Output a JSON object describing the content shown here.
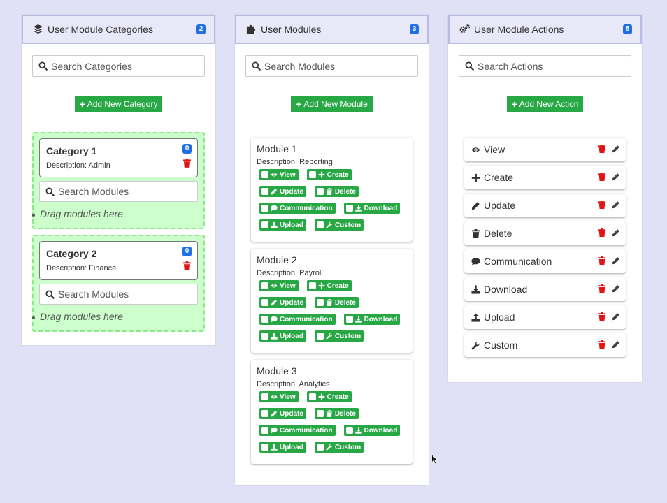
{
  "colors": {
    "accent_green": "#28a745",
    "badge_blue": "#1f6fe6",
    "danger_red": "#e01414",
    "drop_zone": "#ccffcc",
    "background": "#e0e0f7"
  },
  "categories_panel": {
    "title": "User Module Categories",
    "icon": "layers-icon",
    "count": "2",
    "search_placeholder": "Search Categories",
    "add_label": "Add New Category",
    "items": [
      {
        "title": "Category 1",
        "description": "Description: Admin",
        "count": "0",
        "search_placeholder": "Search Modules",
        "drag_hint": "Drag modules here"
      },
      {
        "title": "Category 2",
        "description": "Description: Finance",
        "count": "0",
        "search_placeholder": "Search Modules",
        "drag_hint": "Drag modules here"
      }
    ]
  },
  "modules_panel": {
    "title": "User Modules",
    "icon": "puzzle-icon",
    "count": "3",
    "search_placeholder": "Search Modules",
    "add_label": "Add New Module",
    "items": [
      {
        "title": "Module 1",
        "description": "Description: Reporting"
      },
      {
        "title": "Module 2",
        "description": "Description: Payroll"
      },
      {
        "title": "Module 3",
        "description": "Description: Analytics"
      }
    ],
    "permission_chips": [
      {
        "label": "View",
        "icon": "eye-icon"
      },
      {
        "label": "Create",
        "icon": "plus-icon"
      },
      {
        "label": "Update",
        "icon": "pencil-icon"
      },
      {
        "label": "Delete",
        "icon": "trash-icon"
      },
      {
        "label": "Communication",
        "icon": "comment-icon"
      },
      {
        "label": "Download",
        "icon": "download-icon"
      },
      {
        "label": "Upload",
        "icon": "upload-icon"
      },
      {
        "label": "Custom",
        "icon": "wrench-icon"
      }
    ]
  },
  "actions_panel": {
    "title": "User Module Actions",
    "icon": "cogs-icon",
    "count": "8",
    "search_placeholder": "Search Actions",
    "add_label": "Add New Action",
    "items": [
      {
        "label": "View",
        "icon": "eye-icon"
      },
      {
        "label": "Create",
        "icon": "plus-icon"
      },
      {
        "label": "Update",
        "icon": "pencil-icon"
      },
      {
        "label": "Delete",
        "icon": "trash-icon"
      },
      {
        "label": "Communication",
        "icon": "comment-icon"
      },
      {
        "label": "Download",
        "icon": "download-icon"
      },
      {
        "label": "Upload",
        "icon": "upload-icon"
      },
      {
        "label": "Custom",
        "icon": "wrench-icon"
      }
    ]
  }
}
